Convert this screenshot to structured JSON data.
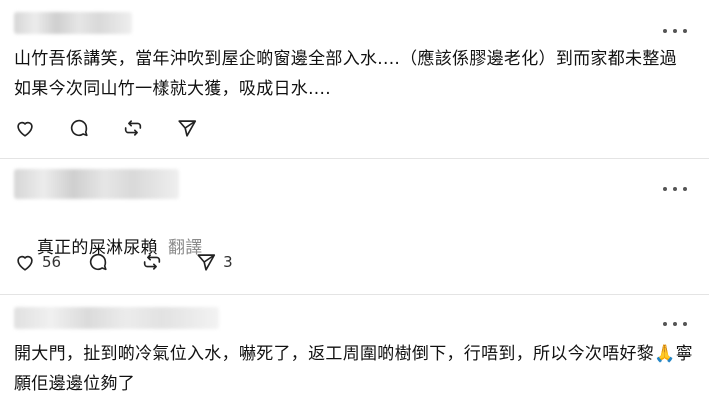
{
  "posts": [
    {
      "text": "山竹吾係講笑，當年沖吹到屋企啲窗邊全部入水....（應該係膠邊老化）到而家都未整過 如果今次同山竹一樣就大獲，吸成日水....",
      "translate_label": "",
      "counts": {
        "like": "",
        "comment": "",
        "repost": "",
        "share": ""
      }
    },
    {
      "text": "真正的屎淋尿賴",
      "translate_label": "翻譯",
      "counts": {
        "like": "56",
        "comment": "",
        "repost": "",
        "share": "3"
      }
    },
    {
      "text": "開大門，扯到啲冷氣位入水，嚇死了，返工周圍啲樹倒下，行唔到，所以今次唔好黎🙏寧願佢邊邊位夠了",
      "translate_label": "",
      "counts": {
        "like": "",
        "comment": "",
        "repost": "",
        "share": ""
      }
    }
  ],
  "icons": {
    "like": "heart-icon",
    "comment": "comment-bubble-icon",
    "repost": "repost-icon",
    "share": "send-icon",
    "more": "more-options-icon"
  },
  "colors": {
    "icon": "#222222",
    "muted": "#8a8a8a",
    "divider": "#e4e4e4"
  }
}
